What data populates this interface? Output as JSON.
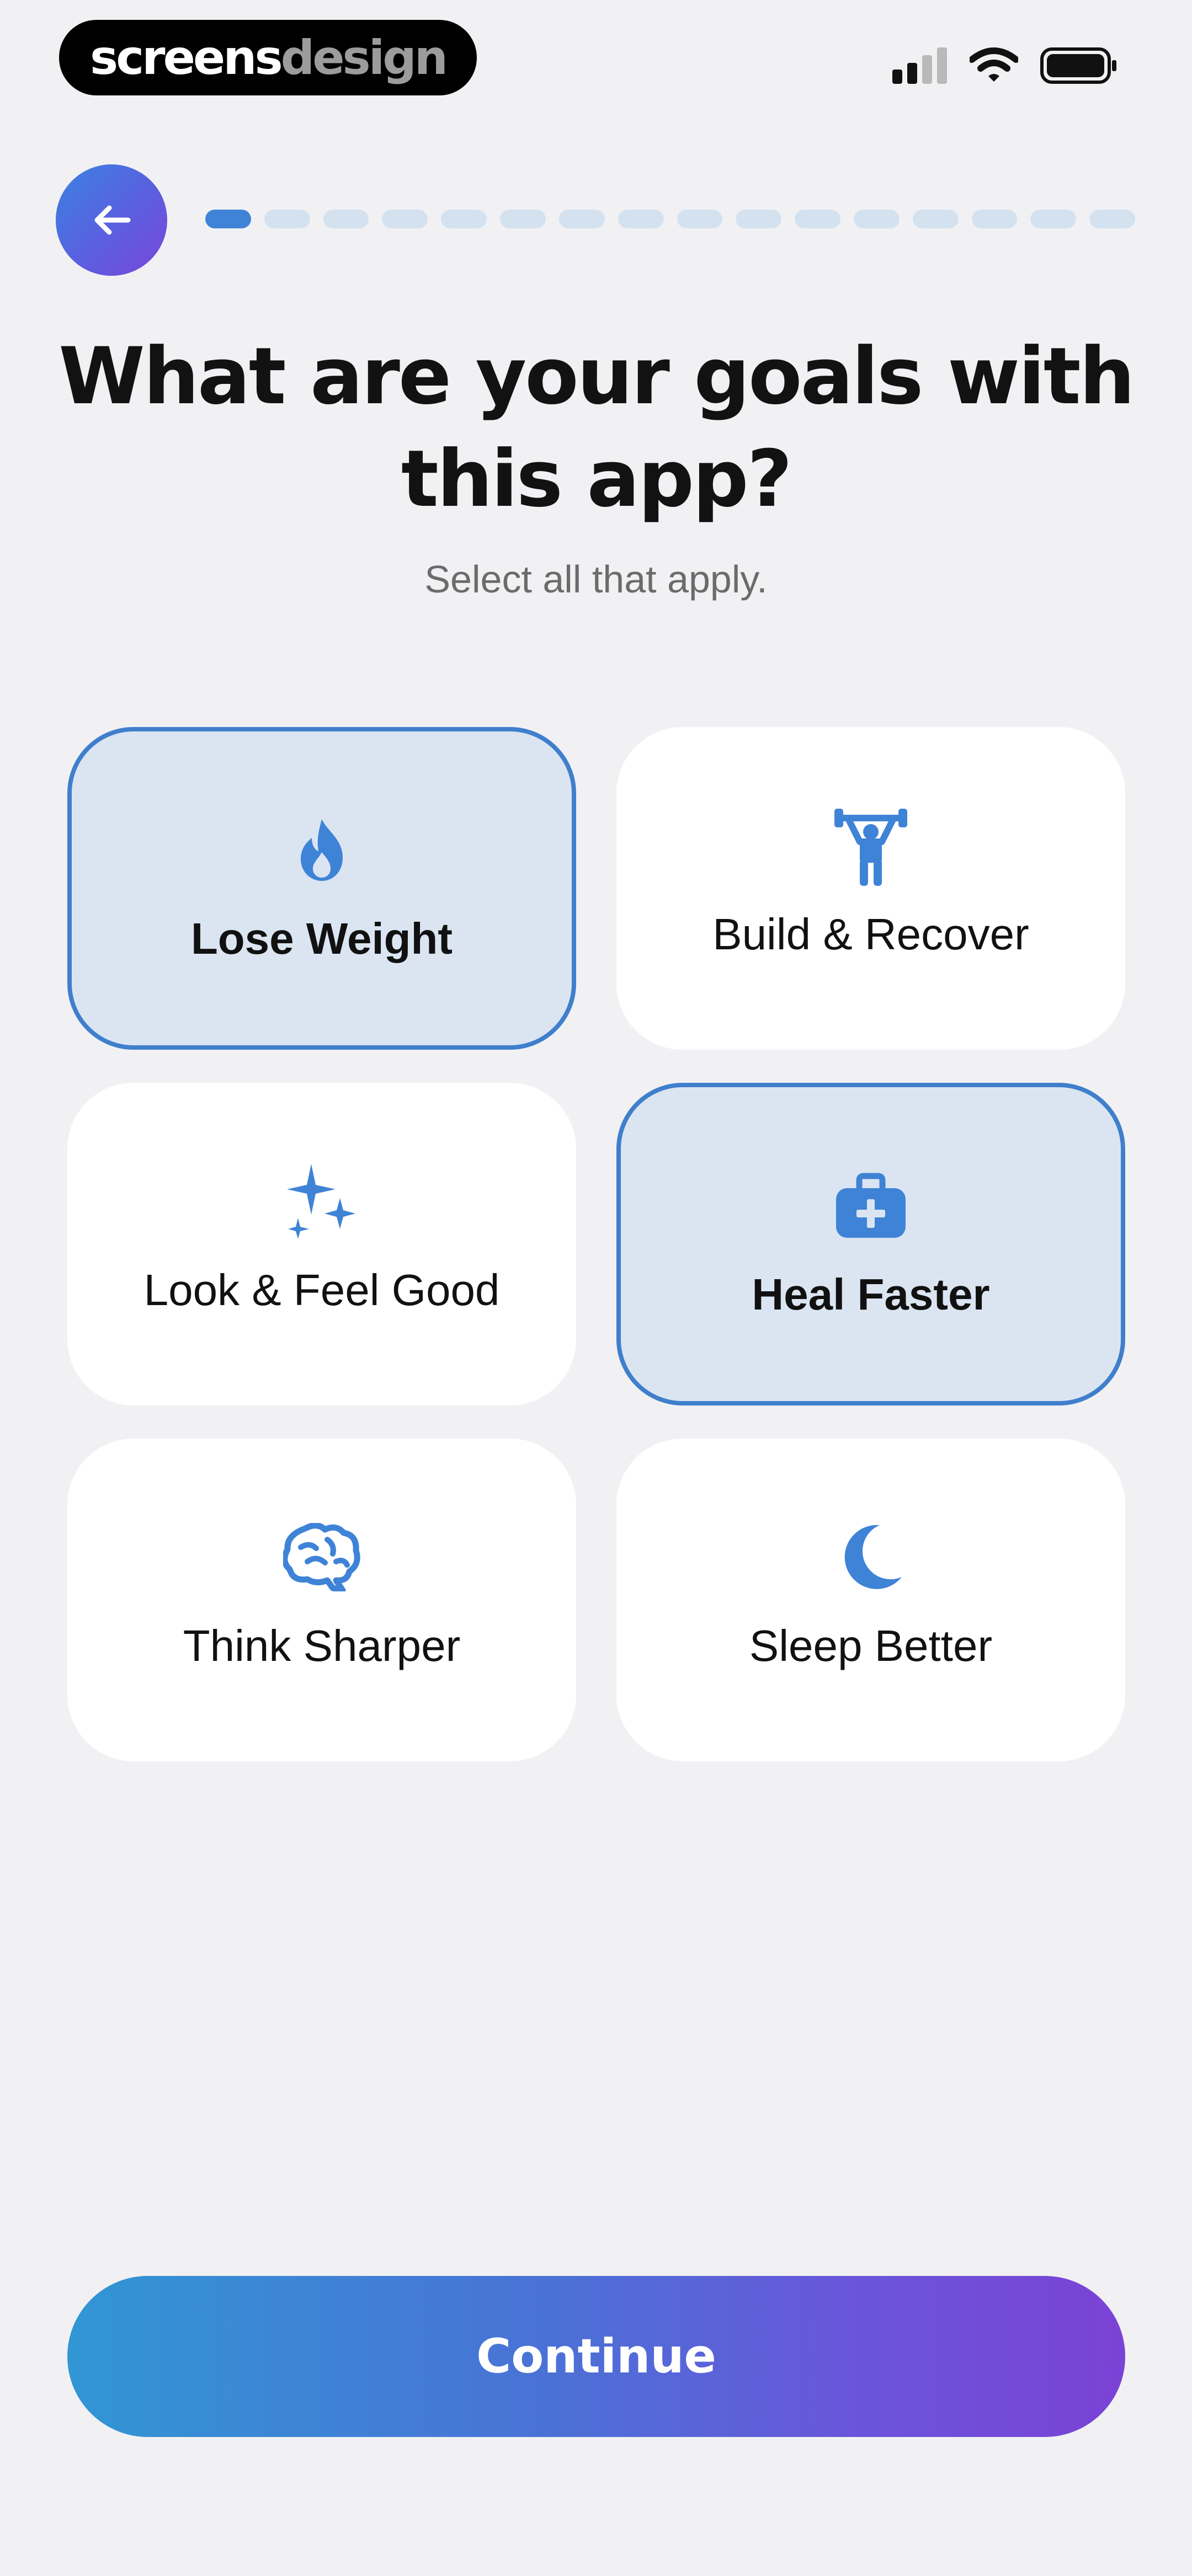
{
  "status_bar": {
    "brand_part1": "screens",
    "brand_part2": "design",
    "icons": [
      "cellular-signal-icon",
      "wifi-icon",
      "battery-icon"
    ]
  },
  "header": {
    "back_icon": "arrow-left-icon",
    "progress": {
      "total_steps": 16,
      "current_step": 1
    }
  },
  "question": {
    "title": "What are your goals with this app?",
    "subtitle": "Select all that apply."
  },
  "goals": [
    {
      "label": "Lose Weight",
      "icon": "flame-icon",
      "selected": true
    },
    {
      "label": "Build & Recover",
      "icon": "weightlifter-icon",
      "selected": false
    },
    {
      "label": "Look & Feel Good",
      "icon": "sparkles-icon",
      "selected": false
    },
    {
      "label": "Heal Faster",
      "icon": "medical-kit-icon",
      "selected": true
    },
    {
      "label": "Think Sharper",
      "icon": "brain-icon",
      "selected": false
    },
    {
      "label": "Sleep Better",
      "icon": "moon-icon",
      "selected": false
    }
  ],
  "footer": {
    "continue_label": "Continue"
  },
  "colors": {
    "accent": "#3f83d6",
    "selected_card_bg": "#dbe5f2",
    "gradient_start": "#3196d4",
    "gradient_end": "#7b42d6"
  }
}
